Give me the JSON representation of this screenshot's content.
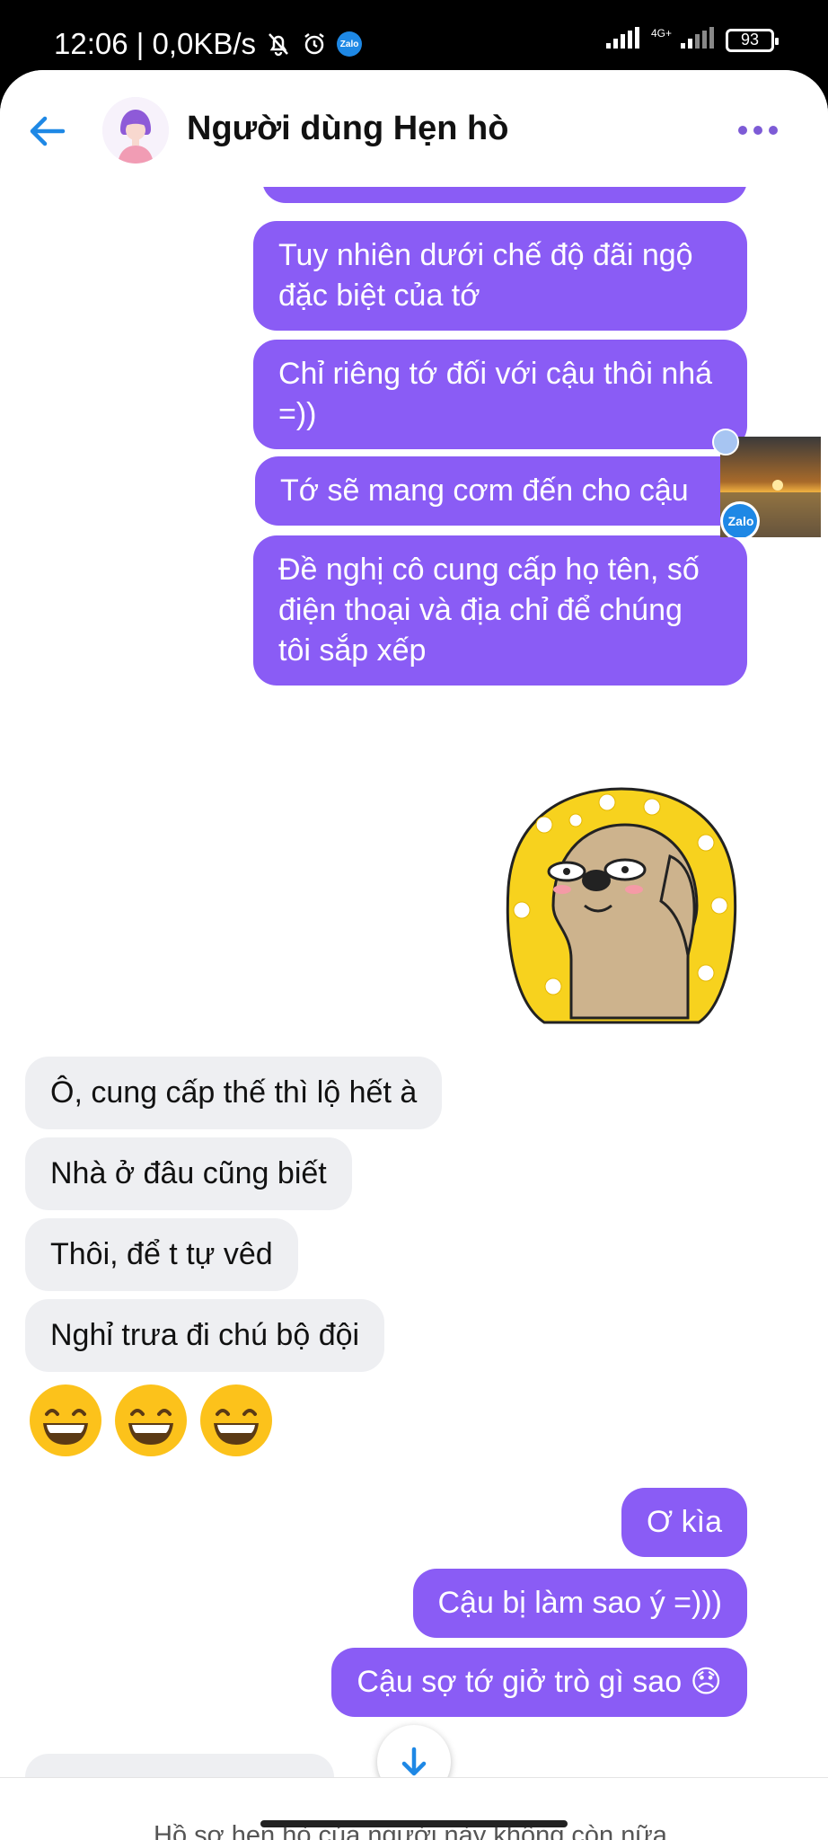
{
  "status_bar": {
    "time_and_speed": "12:06 | 0,0KB/s",
    "network_label": "4G+",
    "battery_level": "93"
  },
  "header": {
    "title": "Người dùng Hẹn hò"
  },
  "messages": {
    "out_1": "Tuy nhiên dưới chế độ đãi ngộ đặc biệt của tớ",
    "out_2": "Chỉ riêng tớ đối với cậu thôi nhá =))",
    "out_3": "Tớ sẽ mang cơm đến cho cậu",
    "out_4": "Đề nghị cô cung cấp họ tên, số điện thoại và địa chỉ để chúng tôi sắp xếp",
    "in_1": "Ô, cung cấp thế thì lộ hết à",
    "in_2": "Nhà ở đâu cũng biết",
    "in_3": "Thôi, để t tự vêd",
    "in_4": "Nghỉ trưa đi chú bộ đội",
    "out_5": "Ơ kìa",
    "out_6": "Cậu bị làm sao ý =)))",
    "out_7": "Cậu sợ tớ giở trò gì sao 😞"
  },
  "floating_bubble": {
    "badge": "Zalo"
  },
  "footer": {
    "notice": "Hồ sơ hẹn hò của người này không còn nữa."
  },
  "colors": {
    "outgoing": "#8a5cf5",
    "incoming": "#eeeff2",
    "accent": "#1e88e5"
  }
}
